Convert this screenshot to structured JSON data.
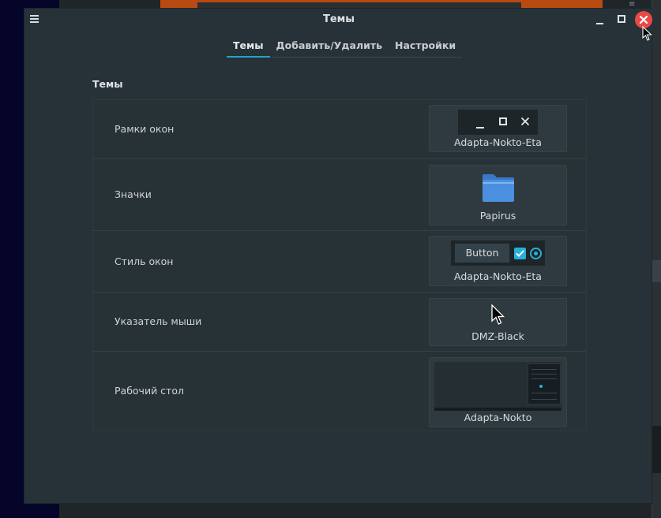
{
  "window": {
    "title": "Темы",
    "menu_icon": "hamburger-icon",
    "controls": [
      "minimize-icon",
      "maximize-icon",
      "close-icon"
    ]
  },
  "tabs": [
    {
      "label": "Темы",
      "active": true
    },
    {
      "label": "Добавить/Удалить",
      "active": false
    },
    {
      "label": "Настройки",
      "active": false
    }
  ],
  "section": {
    "title": "Темы",
    "rows": [
      {
        "label": "Рамки окон",
        "value": "Adapta-Nokto-Eta"
      },
      {
        "label": "Значки",
        "value": "Papirus"
      },
      {
        "label": "Стиль окон",
        "value": "Adapta-Nokto-Eta",
        "button_label": "Button"
      },
      {
        "label": "Указатель мыши",
        "value": "DMZ-Black"
      },
      {
        "label": "Рабочий стол",
        "value": "Adapta-Nokto"
      }
    ]
  },
  "colors": {
    "window_bg": "#263238",
    "accent": "#1fa3c9",
    "close": "#e84a48",
    "folder": "#4a8fe0"
  }
}
